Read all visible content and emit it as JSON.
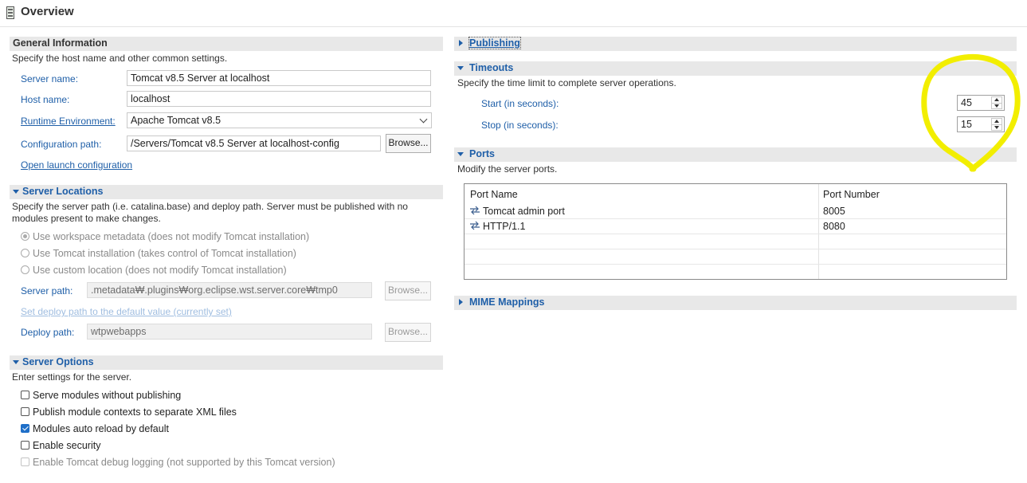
{
  "page": {
    "title": "Overview"
  },
  "general": {
    "header": "General Information",
    "desc": "Specify the host name and other common settings.",
    "server_name_label": "Server name:",
    "server_name_value": "Tomcat v8.5 Server at localhost",
    "host_name_label": "Host name:",
    "host_name_value": "localhost",
    "runtime_label": "Runtime Environment:",
    "runtime_value": "Apache Tomcat v8.5",
    "config_label": "Configuration path:",
    "config_value": "/Servers/Tomcat v8.5 Server at localhost-config",
    "browse_label": "Browse...",
    "open_launch": "Open launch configuration"
  },
  "locations": {
    "header": "Server Locations",
    "desc_line1": "Specify the server path (i.e. catalina.base) and deploy path. Server must be published with no",
    "desc_line2": "modules present to make changes.",
    "options": [
      "Use workspace metadata (does not modify Tomcat installation)",
      "Use Tomcat installation (takes control of Tomcat installation)",
      "Use custom location (does not modify Tomcat installation)"
    ],
    "server_path_label": "Server path:",
    "server_path_value": ".metadata₩.plugins₩org.eclipse.wst.server.core₩tmp0",
    "browse_label": "Browse...",
    "set_default": "Set deploy path to the default value (currently set)",
    "deploy_path_label": "Deploy path:",
    "deploy_path_value": "wtpwebapps",
    "browse2_label": "Browse..."
  },
  "options": {
    "header": "Server Options",
    "desc": "Enter settings for the server.",
    "items": [
      {
        "label": "Serve modules without publishing",
        "checked": false
      },
      {
        "label": "Publish module contexts to separate XML files",
        "checked": false
      },
      {
        "label": "Modules auto reload by default",
        "checked": true
      },
      {
        "label": "Enable security",
        "checked": false
      },
      {
        "label": "Enable Tomcat debug logging (not supported by this Tomcat version)",
        "checked": false,
        "disabled": true
      }
    ]
  },
  "publishing": {
    "header": "Publishing"
  },
  "timeouts": {
    "header": "Timeouts",
    "desc": "Specify the time limit to complete server operations.",
    "start_label": "Start (in seconds):",
    "start_value": "45",
    "stop_label": "Stop (in seconds):",
    "stop_value": "15"
  },
  "ports": {
    "header": "Ports",
    "desc": "Modify the server ports.",
    "col_name": "Port Name",
    "col_number": "Port Number",
    "rows": [
      {
        "name": "Tomcat admin port",
        "number": "8005"
      },
      {
        "name": "HTTP/1.1",
        "number": "8080"
      }
    ]
  },
  "mime": {
    "header": "MIME Mappings"
  },
  "colors": {
    "accent": "#1f5fa8",
    "highlight": "#f2ee00"
  }
}
